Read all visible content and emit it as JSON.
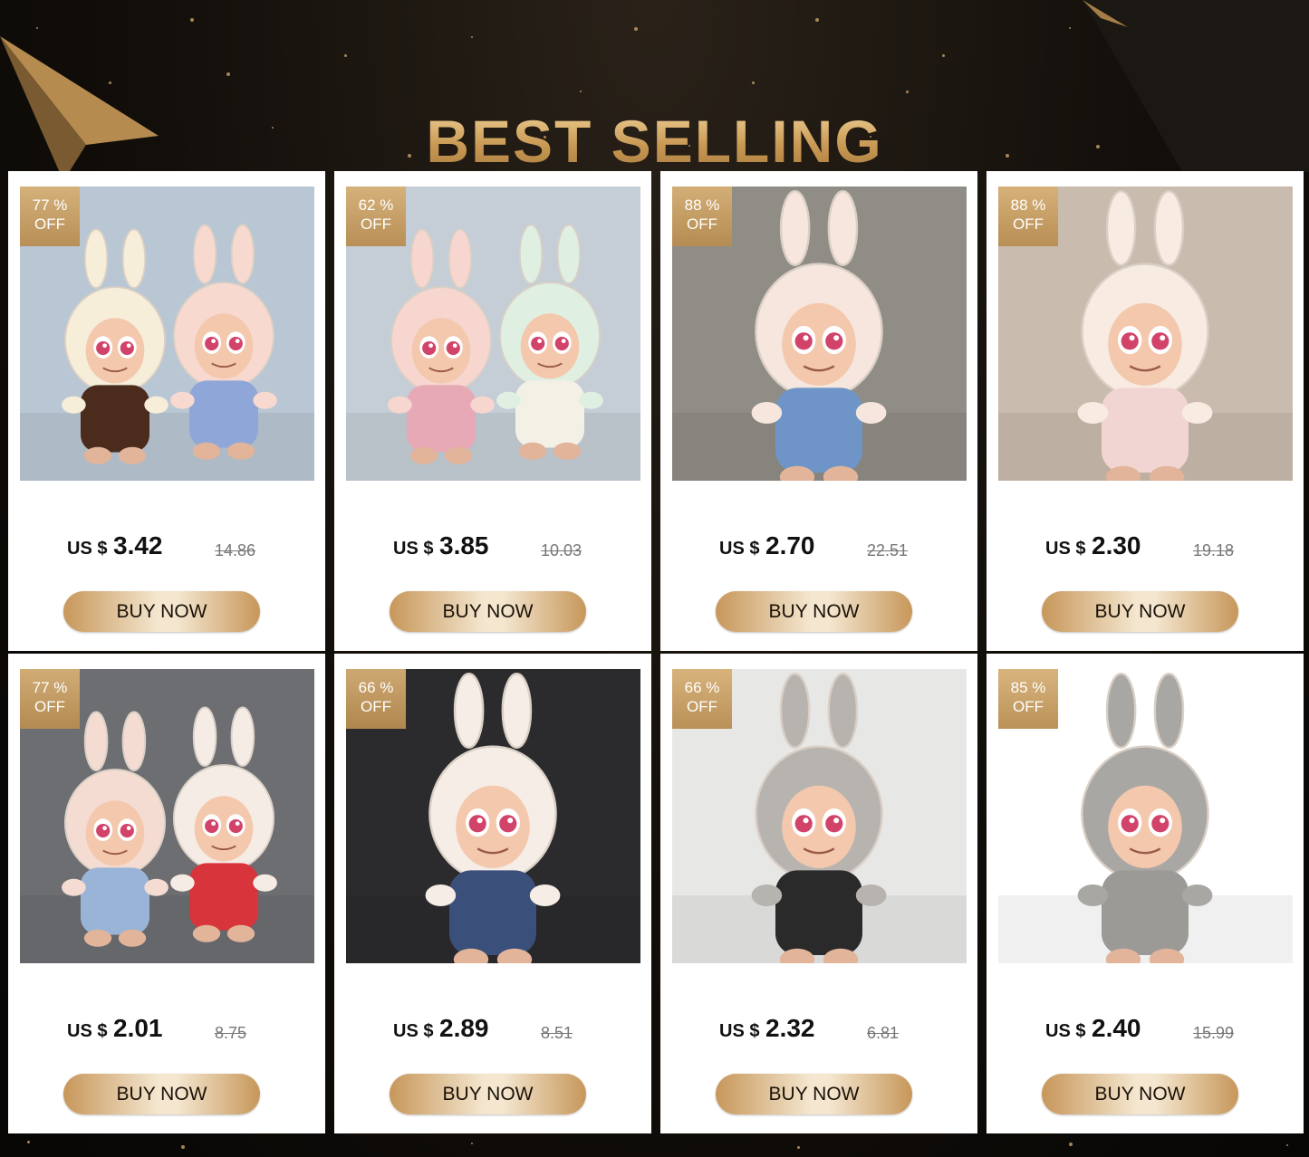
{
  "page": {
    "title": "BEST SELLING"
  },
  "colors": {
    "gold": "#d2ab6e",
    "background": "#0b0907",
    "button_gradient": "#c7975a"
  },
  "products": [
    {
      "discount": "77 %",
      "off": "OFF",
      "currency": "US $",
      "price": "3.42",
      "original": "14.86",
      "button": "BUY NOW",
      "scene": "bg-blue",
      "doll1": "#f6eed9",
      "doll2": "#f7d9cf",
      "outfit1": "#4a2b1c",
      "outfit2": "#8ea7d8"
    },
    {
      "discount": "62 %",
      "off": "OFF",
      "currency": "US $",
      "price": "3.85",
      "original": "10.03",
      "button": "BUY NOW",
      "scene": "bg-grey",
      "doll1": "#f6d6cf",
      "doll2": "#dff0e2",
      "outfit1": "#e8a9b7",
      "outfit2": "#f3f0e6"
    },
    {
      "discount": "88 %",
      "off": "OFF",
      "currency": "US $",
      "price": "2.70",
      "original": "22.51",
      "button": "BUY NOW",
      "scene": "bg-blossom",
      "doll1": "#f7e6dd",
      "doll2": "",
      "outfit1": "#6f95c8",
      "outfit2": ""
    },
    {
      "discount": "88 %",
      "off": "OFF",
      "currency": "US $",
      "price": "2.30",
      "original": "19.18",
      "button": "BUY NOW",
      "scene": "bg-warm",
      "doll1": "#f8ebe2",
      "doll2": "",
      "outfit1": "#f1d5d3",
      "outfit2": ""
    },
    {
      "discount": "77 %",
      "off": "OFF",
      "currency": "US $",
      "price": "2.01",
      "original": "8.75",
      "button": "BUY NOW",
      "scene": "bg-street",
      "doll1": "#f4dcd2",
      "doll2": "#f6ece6",
      "outfit1": "#9ab4d8",
      "outfit2": "#d8343c"
    },
    {
      "discount": "66 %",
      "off": "OFF",
      "currency": "US $",
      "price": "2.89",
      "original": "8.51",
      "button": "BUY NOW",
      "scene": "bg-dark",
      "doll1": "#f5ede6",
      "doll2": "",
      "outfit1": "#3a4f7a",
      "outfit2": ""
    },
    {
      "discount": "66 %",
      "off": "OFF",
      "currency": "US $",
      "price": "2.32",
      "original": "6.81",
      "button": "BUY NOW",
      "scene": "bg-light",
      "doll1": "#b7b4b0",
      "doll2": "",
      "outfit1": "#2a2a2a",
      "outfit2": ""
    },
    {
      "discount": "85 %",
      "off": "OFF",
      "currency": "US $",
      "price": "2.40",
      "original": "15.99",
      "button": "BUY NOW",
      "scene": "bg-white",
      "doll1": "#a9a7a4",
      "doll2": "",
      "outfit1": "#9c9a97",
      "outfit2": ""
    }
  ]
}
